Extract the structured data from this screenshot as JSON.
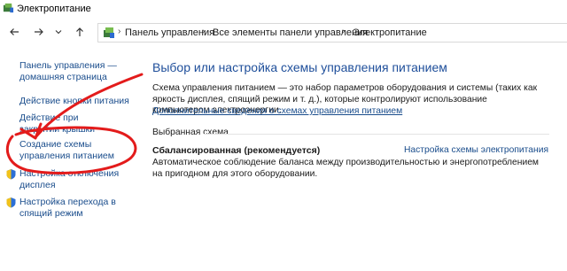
{
  "window": {
    "title": "Электропитание"
  },
  "breadcrumb": {
    "items": [
      "Панель управления",
      "Все элементы панели управления",
      "Электропитание"
    ]
  },
  "sidebar": {
    "items": [
      {
        "label": "Панель управления — домашняя страница"
      },
      {
        "label": "Действие кнопки питания"
      },
      {
        "label": "Действие при закрытии крышки"
      },
      {
        "label": "Создание схемы управления питанием"
      },
      {
        "label": "Настройка отключения дисплея"
      },
      {
        "label": "Настройка перехода в спящий режим"
      }
    ]
  },
  "main": {
    "title": "Выбор или настройка схемы управления питанием",
    "description": "Схема управления питанием — это набор параметров оборудования и системы (таких как яркость дисплея, спящий режим и т. д.), которые контролируют использование компьютером электроэнергии.",
    "more_link": "Дополнительные сведения о схемах управления питанием",
    "section_label": "Выбранная схема",
    "plan": {
      "name": "Сбалансированная (рекомендуется)",
      "settings_link": "Настройка схемы электропитания",
      "description": "Автоматическое соблюдение баланса между производительностью и энергопотреблением на пригодном для этого оборудовании."
    }
  },
  "icons": {
    "back": "arrow-left-icon",
    "forward": "arrow-right-icon",
    "recent": "chevron-down-icon",
    "up": "arrow-up-icon",
    "control_panel": "control-panel-icon",
    "shield": "shield-icon"
  },
  "colors": {
    "link": "#1a4d8c",
    "title": "#1e4e9a",
    "annotation": "#e31b1b"
  }
}
